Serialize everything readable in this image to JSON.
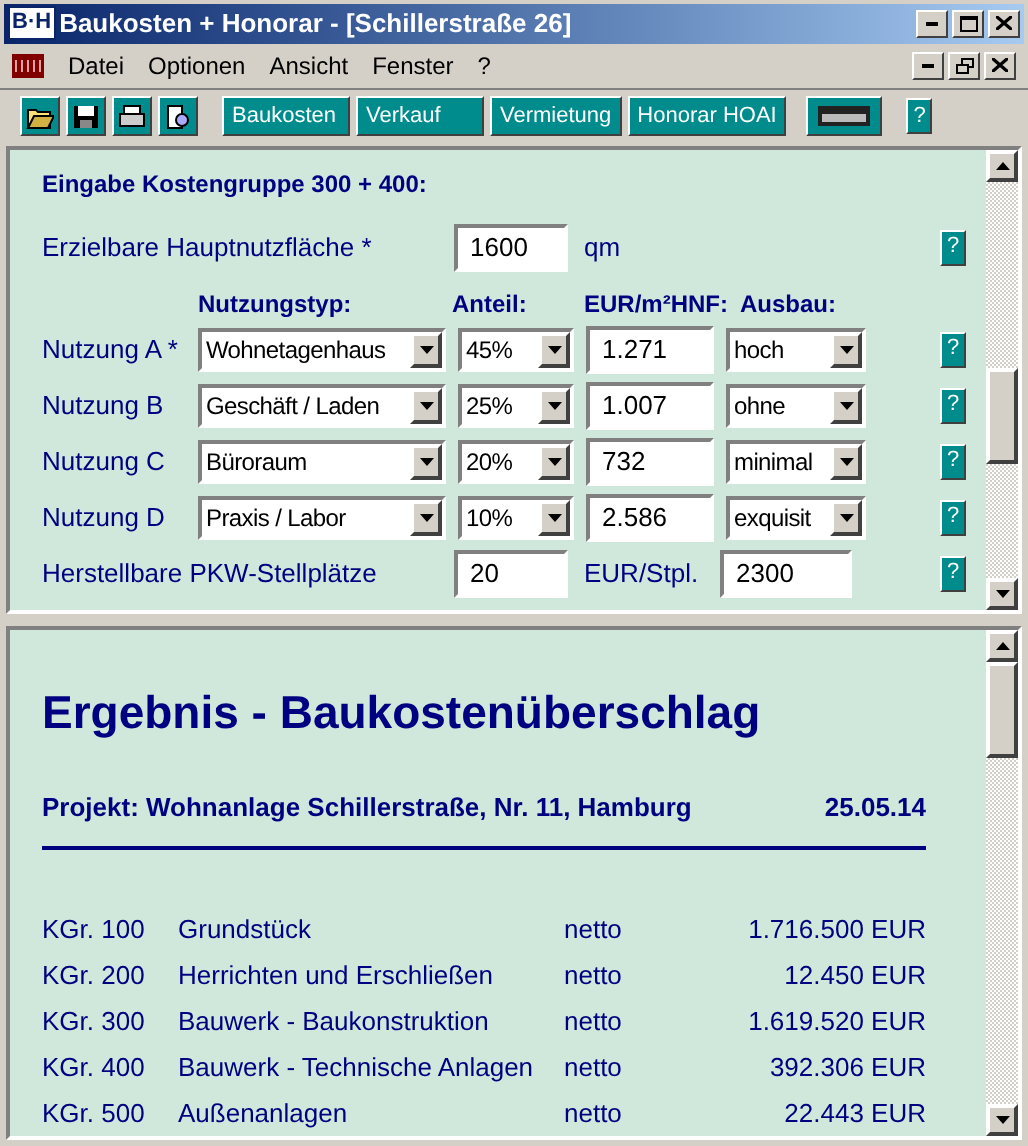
{
  "window": {
    "logo": "B·H",
    "title": "Baukosten + Honorar - [Schillerstraße 26]"
  },
  "menu": [
    "Datei",
    "Optionen",
    "Ansicht",
    "Fenster",
    "?"
  ],
  "toolbar": {
    "modules": [
      "Baukosten",
      "Verkauf",
      "Vermietung",
      "Honorar HOAI"
    ],
    "help": "?"
  },
  "input": {
    "heading": "Eingabe Kostengruppe 300 + 400:",
    "area": {
      "label": "Erzielbare Hauptnutzfläche *",
      "value": "1600",
      "unit": "qm",
      "help": "?"
    },
    "columns": [
      "Nutzungstyp:",
      "Anteil:",
      "EUR/m²HNF:",
      "Ausbau:"
    ],
    "rows": [
      {
        "label": "Nutzung A *",
        "type": "Wohnetagenhaus",
        "share": "45%",
        "price": "1.271",
        "finish": "hoch",
        "help": "?"
      },
      {
        "label": "Nutzung B",
        "type": "Geschäft / Laden",
        "share": "25%",
        "price": "1.007",
        "finish": "ohne",
        "help": "?"
      },
      {
        "label": "Nutzung C",
        "type": "Büroraum",
        "share": "20%",
        "price": "732",
        "finish": "minimal",
        "help": "?"
      },
      {
        "label": "Nutzung D",
        "type": "Praxis / Labor",
        "share": "10%",
        "price": "2.586",
        "finish": "exquisit",
        "help": "?"
      }
    ],
    "parking": {
      "label": "Herstellbare PKW-Stellplätze",
      "value": "20",
      "unit": "EUR/Stpl.",
      "price": "2300",
      "help": "?"
    }
  },
  "result": {
    "title": "Ergebnis - Baukostenüberschlag",
    "project": "Projekt: Wohnanlage Schillerstraße, Nr. 11, Hamburg",
    "date": "25.05.14",
    "rows": [
      {
        "group": "KGr. 100",
        "name": "Grundstück",
        "basis": "netto",
        "amount": "1.716.500 EUR"
      },
      {
        "group": "KGr. 200",
        "name": "Herrichten und Erschließen",
        "basis": "netto",
        "amount": "12.450 EUR"
      },
      {
        "group": "KGr. 300",
        "name": "Bauwerk - Baukonstruktion",
        "basis": "netto",
        "amount": "1.619.520 EUR"
      },
      {
        "group": "KGr. 400",
        "name": "Bauwerk - Technische Anlagen",
        "basis": "netto",
        "amount": "392.306 EUR"
      },
      {
        "group": "KGr. 500",
        "name": "Außenanlagen",
        "basis": "netto",
        "amount": "22.443 EUR"
      }
    ]
  }
}
